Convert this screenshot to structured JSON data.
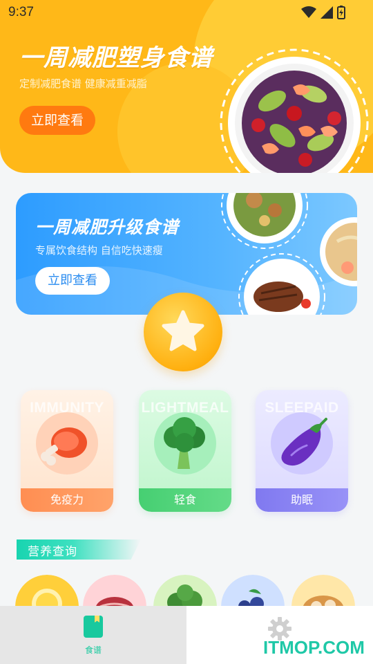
{
  "status_bar": {
    "time": "9:37"
  },
  "hero": {
    "title": "一周减肥塑身食谱",
    "subtitle": "定制减肥食谱 健康减重减脂",
    "button": "立即查看"
  },
  "banner2": {
    "title": "一周减肥升级食谱",
    "subtitle": "专属饮食结构 自信吃快速瘦",
    "button": "立即查看"
  },
  "categories": [
    {
      "en": "IMMUNITY",
      "label": "免疫力",
      "icon": "meat-icon",
      "color": "#ff8e52"
    },
    {
      "en": "LIGHTMEAL",
      "label": "轻食",
      "icon": "broccoli-icon",
      "color": "#46cf72"
    },
    {
      "en": "SLEEPAID",
      "label": "助眠",
      "icon": "eggplant-icon",
      "color": "#8079f0"
    }
  ],
  "nutrition": {
    "title": "营养查询"
  },
  "tabs": [
    {
      "label": "食谱",
      "icon": "recipe-book-icon",
      "active": true
    },
    {
      "label": "",
      "icon": "gear-icon",
      "active": false
    }
  ],
  "watermark": "ITMOP.COM"
}
